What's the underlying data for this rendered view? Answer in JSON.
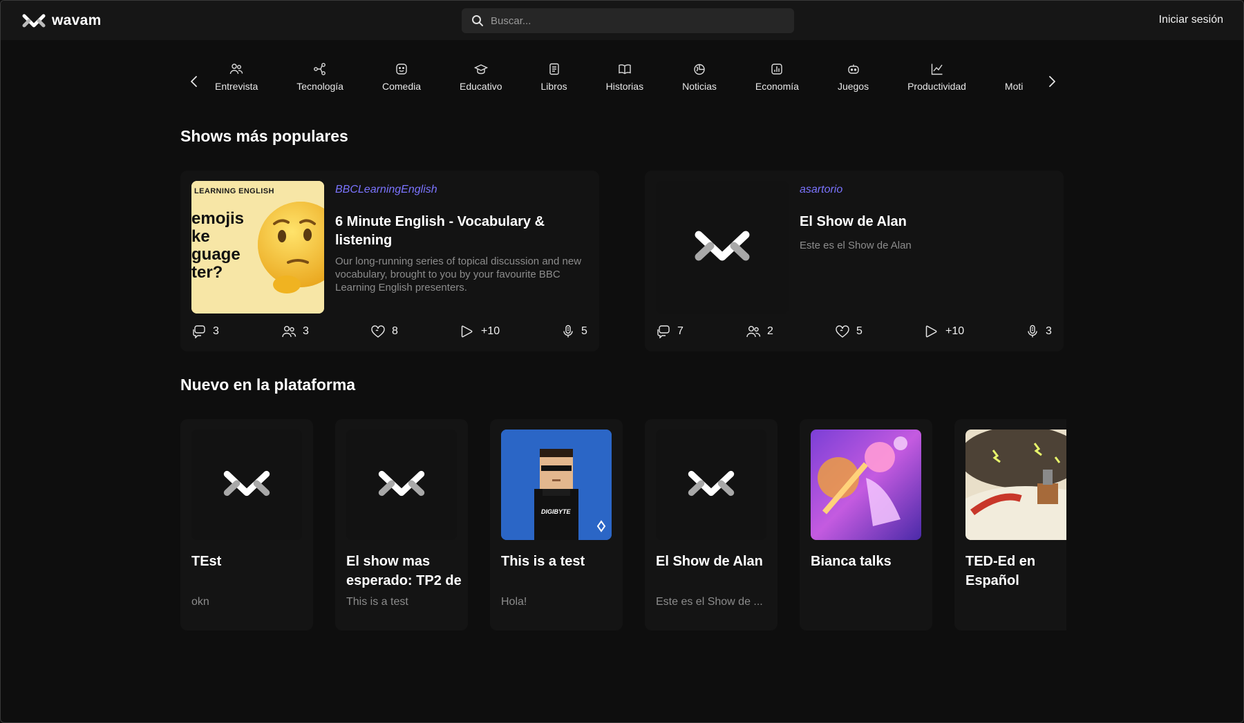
{
  "header": {
    "brand": "wavam",
    "search_placeholder": "Buscar...",
    "login_label": "Iniciar sesión"
  },
  "categories": [
    {
      "label": "Entrevista",
      "icon": "users-icon"
    },
    {
      "label": "Tecnología",
      "icon": "share-nodes-icon"
    },
    {
      "label": "Comedia",
      "icon": "mask-smile-icon"
    },
    {
      "label": "Educativo",
      "icon": "graduation-cap-icon"
    },
    {
      "label": "Libros",
      "icon": "notebook-icon"
    },
    {
      "label": "Historias",
      "icon": "open-book-icon"
    },
    {
      "label": "Noticias",
      "icon": "globe-chart-icon"
    },
    {
      "label": "Economía",
      "icon": "bar-chart-icon"
    },
    {
      "label": "Juegos",
      "icon": "robot-icon"
    },
    {
      "label": "Productividad",
      "icon": "line-chart-icon"
    },
    {
      "label": "Moti",
      "icon": "none"
    }
  ],
  "sections": {
    "popular_title": "Shows más populares",
    "new_title": "Nuevo en la plataforma"
  },
  "popular": [
    {
      "author": "BBCLearningEnglish",
      "title": "6 Minute English - Vocabulary & listening",
      "description": "Our long-running series of topical discussion and new vocabulary, brought to you by your favourite BBC Learning English presenters.",
      "thumb_text": {
        "brand": "LEARNING ENGLISH",
        "lines": [
          "emojis",
          "ke",
          "guage",
          "ter?"
        ]
      },
      "stats": {
        "comments": "3",
        "followers": "3",
        "likes": "8",
        "plays": "+10",
        "episodes": "5"
      }
    },
    {
      "author": "asartorio",
      "title": "El Show de Alan",
      "description": "Este es el Show de Alan",
      "stats": {
        "comments": "7",
        "followers": "2",
        "likes": "5",
        "plays": "+10",
        "episodes": "3"
      }
    }
  ],
  "new_shows": [
    {
      "title": "TEst",
      "description": "okn",
      "thumb": "placeholder"
    },
    {
      "title": "El show mas esperado: TP2 de",
      "description": "This is a test",
      "thumb": "placeholder"
    },
    {
      "title": "This is a test",
      "description": "Hola!",
      "thumb": "pixel-avatar",
      "thumb_text": "DIGIBYTE"
    },
    {
      "title": "El Show de Alan",
      "description": "Este es el Show de ...",
      "thumb": "placeholder"
    },
    {
      "title": "Bianca talks",
      "description": "",
      "thumb": "fantasy-art"
    },
    {
      "title": "TED-Ed en Español",
      "description": "",
      "thumb": "illustration"
    }
  ],
  "colors": {
    "background": "#0e0e0e",
    "header": "#161616",
    "card": "#131313",
    "accent_author": "#7b74ff",
    "muted_text": "#8c8c8c"
  }
}
